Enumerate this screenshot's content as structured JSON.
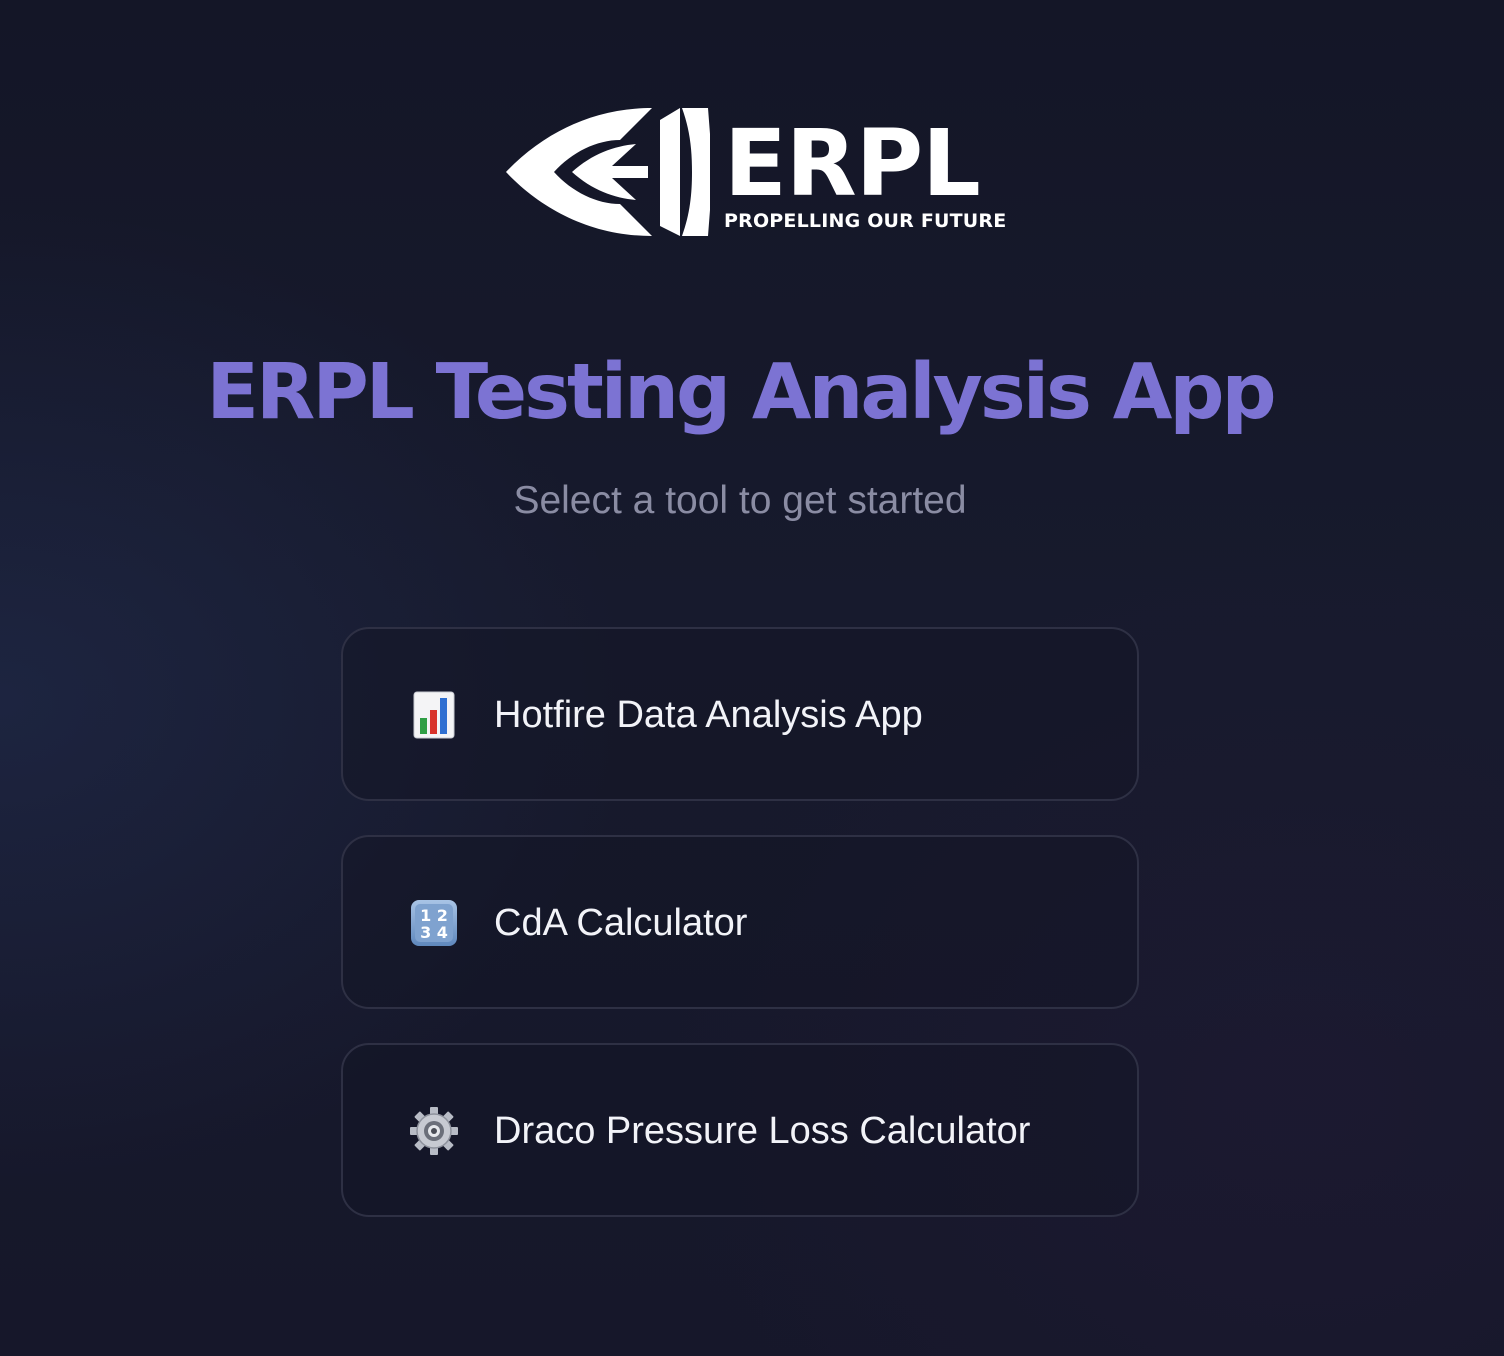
{
  "logo": {
    "wordmark": "ERPL",
    "tagline": "PROPELLING OUR FUTURE"
  },
  "page": {
    "title": "ERPL Testing Analysis App",
    "subtitle": "Select a tool to get started"
  },
  "tools": [
    {
      "label": "Hotfire Data Analysis App",
      "icon": "bar-chart-icon"
    },
    {
      "label": "CdA Calculator",
      "icon": "numbers-keycap-icon"
    },
    {
      "label": "Draco Pressure Loss Calculator",
      "icon": "gear-icon"
    }
  ],
  "colors": {
    "background": "#16182b",
    "title": "#7c73d3",
    "subtitle": "#8a8ca3",
    "card_border": "#2e3044",
    "card_text": "#f2f3f8"
  }
}
